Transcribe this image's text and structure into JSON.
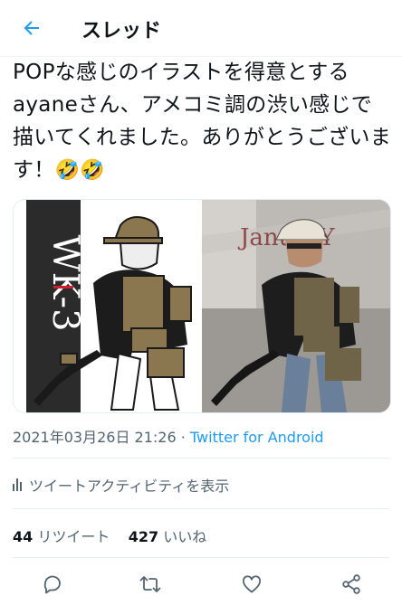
{
  "header": {
    "title": "スレッド"
  },
  "tweet": {
    "text": "POPな感じのイラストを得意とするayaneさん、アメコミ調の渋い感じで描いてくれました。ありがとうございます！",
    "emojis": "🤣🤣",
    "left_image_text": "WK-3",
    "right_image_text": "JanuarY",
    "timestamp": "2021年03月26日 21:26",
    "separator": " · ",
    "source": "Twitter for Android",
    "activity_label": "ツイートアクティビティを表示",
    "retweet_count": "44",
    "retweet_label": "リツイート",
    "like_count": "427",
    "like_label": "いいね"
  },
  "colors": {
    "accent": "#1d9bf0",
    "secondary_text": "#536471",
    "khaki": "#8a7750"
  },
  "icons": [
    "back-arrow-icon",
    "activity-chart-icon",
    "reply-icon",
    "retweet-icon",
    "like-icon",
    "share-icon"
  ]
}
